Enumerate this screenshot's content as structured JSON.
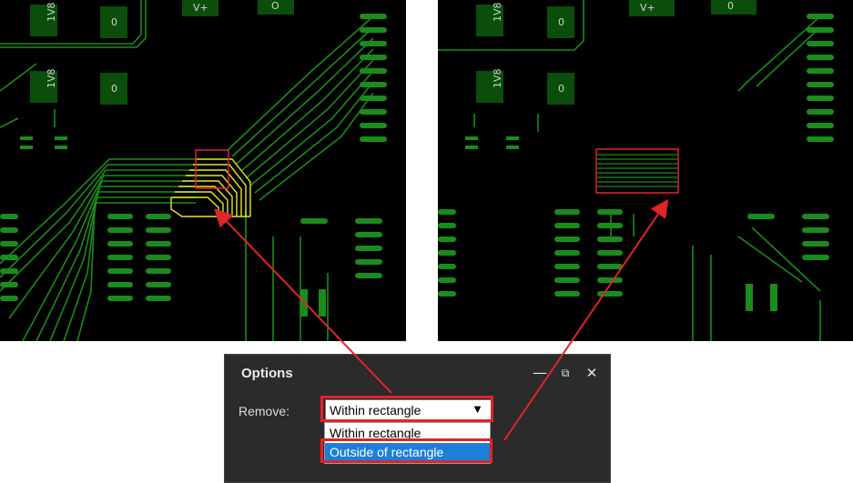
{
  "options": {
    "title": "Options",
    "remove_label": "Remove:",
    "selected_value": "Within rectangle",
    "dropdown_options": [
      "Within rectangle",
      "Outside of rectangle"
    ],
    "highlighted_option": "Outside of rectangle"
  },
  "pcb_left": {
    "labels": [
      "1V8",
      "0",
      "V+",
      "O",
      "1V8",
      "0"
    ]
  },
  "pcb_right": {
    "labels": [
      "1V8",
      "0",
      "V+",
      "0",
      "1V8",
      "0"
    ]
  },
  "colors": {
    "trace": "#1a8c1a",
    "pad": "#0b4d0b",
    "highlight": "#e0242a",
    "selected_trace": "#e8e820",
    "list_selection": "#1e7fd8"
  }
}
